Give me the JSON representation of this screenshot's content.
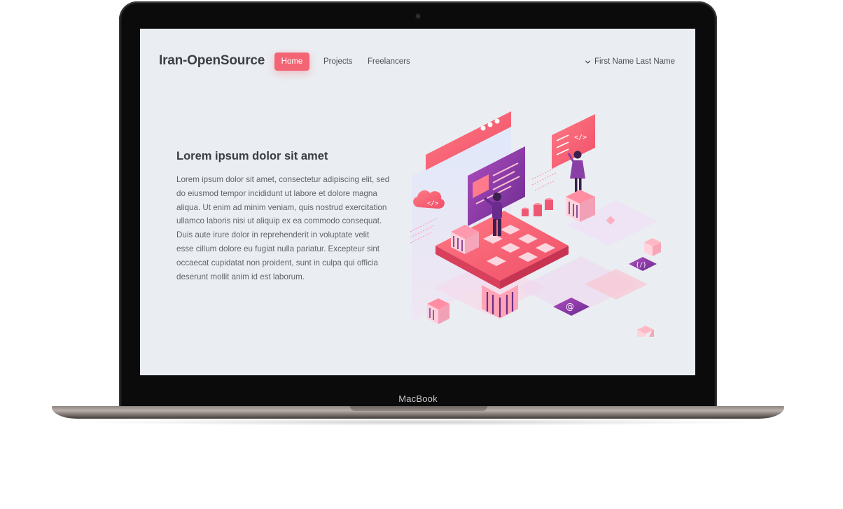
{
  "device": {
    "brand_label": "MacBook"
  },
  "nav": {
    "logo": "Iran-OpenSource",
    "items": [
      {
        "label": "Home",
        "active": true
      },
      {
        "label": "Projects",
        "active": false
      },
      {
        "label": "Freelancers",
        "active": false
      }
    ],
    "user": {
      "name": "First Name Last Name",
      "icon": "chevron-down-icon"
    }
  },
  "hero": {
    "title": "Lorem ipsum dolor sit amet",
    "lines": [
      "Lorem ipsum dolor sit amet, consectetur adipiscing elit, sed",
      "do eiusmod tempor incididunt ut labore et dolore magna",
      "aliqua. Ut enim ad minim veniam, quis nostrud exercitation",
      "ullamco laboris nisi ut aliquip ex ea commodo consequat.",
      "Duis aute irure dolor in reprehenderit in voluptate velit",
      "esse cillum dolore eu fugiat nulla pariatur. Excepteur sint",
      "occaecat cupidatat non proident, sunt in culpa qui officia",
      "deserunt mollit anim id est laborum."
    ]
  },
  "illustration": {
    "icons": [
      "code-icon",
      "cloud-code-icon",
      "at-sign-icon",
      "curly-braces-icon"
    ]
  },
  "colors": {
    "accent": "#f36574",
    "purple": "#8a3fa8",
    "screen_bg": "#eaeef2",
    "text_dark": "#3a3e44"
  }
}
